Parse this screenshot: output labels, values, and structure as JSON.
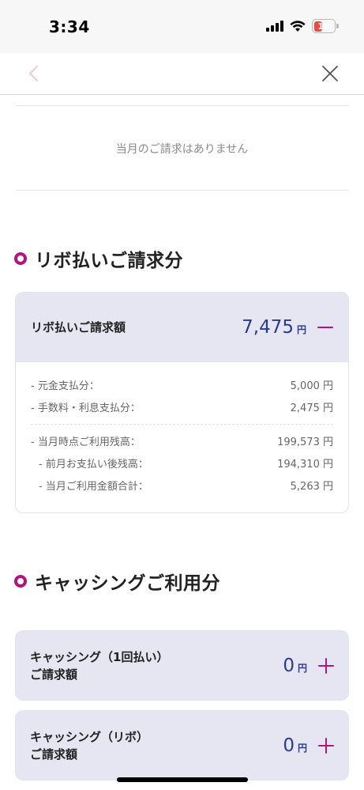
{
  "status_bar": {
    "time": "3:34",
    "battery_level": "19",
    "battery_color": "#eb4d3d"
  },
  "nav": {
    "back_icon": "chevron-left-icon",
    "close_icon": "close-icon"
  },
  "notice": {
    "no_billing_text": "当月のご請求はありません"
  },
  "revolving": {
    "section_title": "リボ払いご請求分",
    "card": {
      "label": "リボ払いご請求額",
      "amount": "7,475",
      "unit": "円",
      "toggle": "minus-icon",
      "rows": [
        {
          "label": "- 元金支払分：",
          "value": "5,000 円"
        },
        {
          "label": "- 手数料・利息支払分：",
          "value": "2,475 円"
        }
      ],
      "balance_rows": [
        {
          "label": "- 当月時点ご利用残高：",
          "value": "199,573 円"
        },
        {
          "label": "- 前月お支払い後残高：",
          "value": "194,310 円"
        },
        {
          "label": "- 当月ご利用金額合計：",
          "value": "5,263 円"
        }
      ]
    }
  },
  "cashing": {
    "section_title": "キャッシングご利用分",
    "cards": [
      {
        "label_line1": "キャッシング（1回払い）",
        "label_line2": "ご請求額",
        "amount": "0",
        "unit": "円",
        "toggle": "plus-icon"
      },
      {
        "label_line1": "キャッシング（リボ）",
        "label_line2": "ご請求額",
        "amount": "0",
        "unit": "円",
        "toggle": "plus-icon"
      }
    ]
  },
  "colors": {
    "accent": "#b4147f",
    "amount": "#2a3a8c",
    "card_header_bg": "#e6e6f2"
  }
}
